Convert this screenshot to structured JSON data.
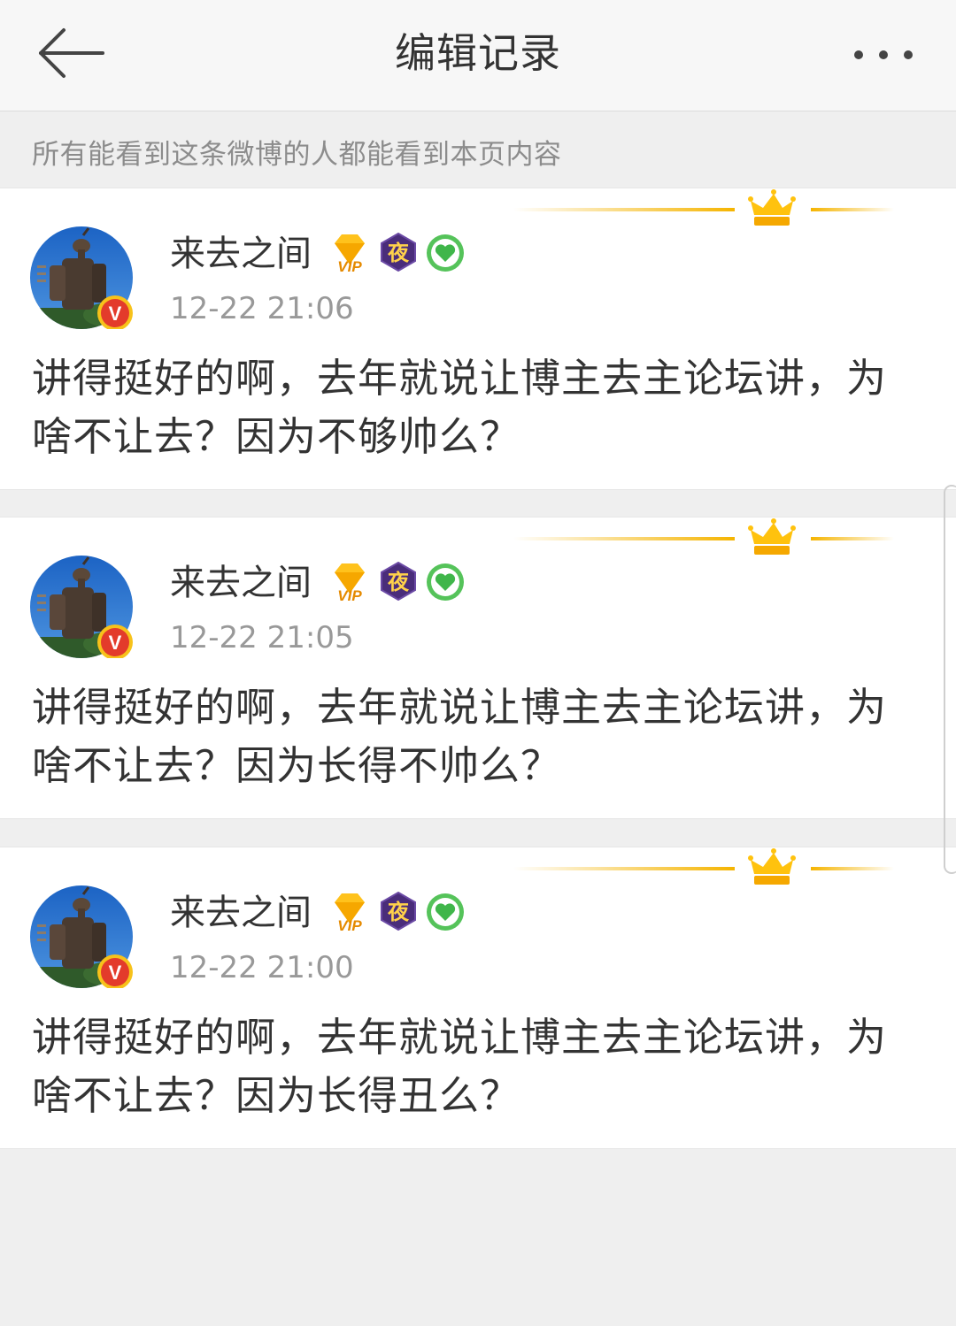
{
  "header": {
    "title": "编辑记录"
  },
  "notice": "所有能看到这条微博的人都能看到本页内容",
  "colors": {
    "accent_gold": "#f5b400",
    "verified_red": "#e33b2b",
    "night_purple": "#4a2d7a",
    "green_heart": "#55c35a"
  },
  "records": [
    {
      "username": "来去之间",
      "time": "12-22 21:06",
      "content": "讲得挺好的啊，去年就说让博主去主论坛讲，为啥不让去？因为不够帅么？"
    },
    {
      "username": "来去之间",
      "time": "12-22 21:05",
      "content": "讲得挺好的啊，去年就说让博主去主论坛讲，为啥不让去？因为长得不帅么？"
    },
    {
      "username": "来去之间",
      "time": "12-22 21:00",
      "content": "讲得挺好的啊，去年就说让博主去主论坛讲，为啥不让去？因为长得丑么？"
    }
  ],
  "badges": {
    "vip_text": "VIP",
    "night_text": "夜"
  },
  "verified_mark": "V"
}
